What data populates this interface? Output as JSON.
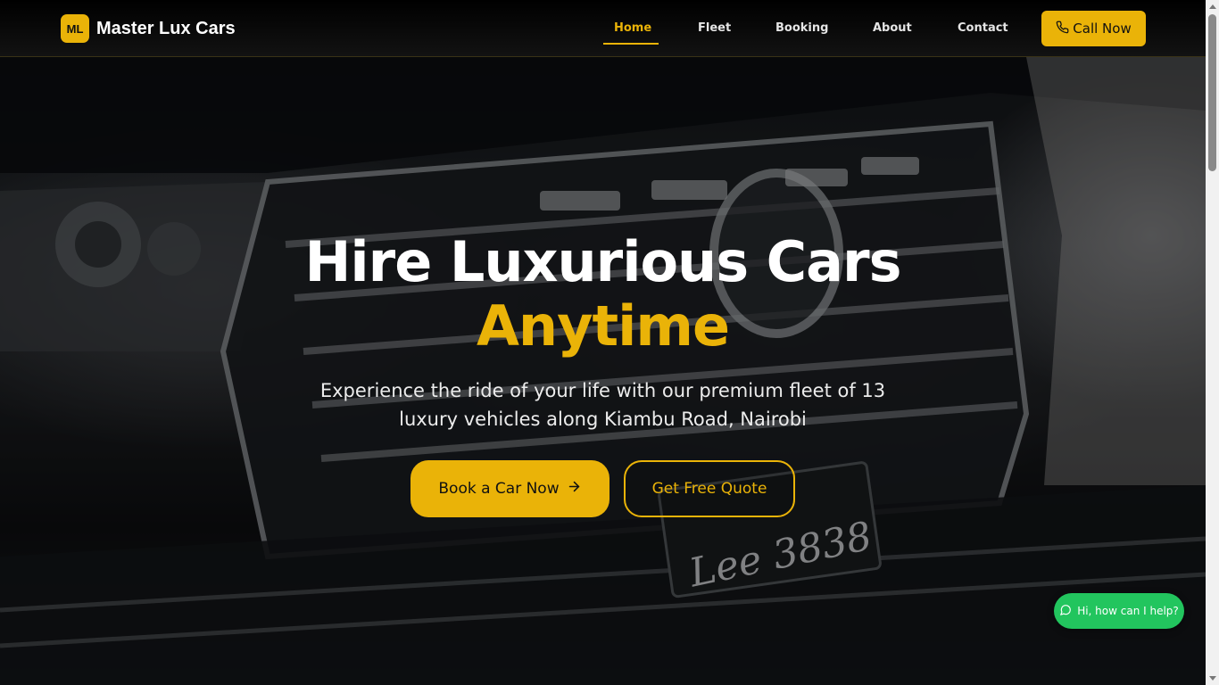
{
  "header": {
    "logo_badge": "ML",
    "brand_name": "Master Lux Cars",
    "nav": [
      {
        "label": "Home",
        "active": true
      },
      {
        "label": "Fleet",
        "active": false
      },
      {
        "label": "Booking",
        "active": false
      },
      {
        "label": "About",
        "active": false
      },
      {
        "label": "Contact",
        "active": false
      }
    ],
    "call_button": {
      "label": "Call Now",
      "icon": "phone-icon"
    }
  },
  "hero": {
    "title_line1": "Hire Luxurious Cars",
    "title_line2": "Anytime",
    "subtitle": "Experience the ride of your life with our premium fleet of 13 luxury vehicles along Kiambu Road, Nairobi",
    "primary_button": {
      "label": "Book a Car Now",
      "icon": "arrow-right-icon"
    },
    "secondary_button": {
      "label": "Get Free Quote"
    },
    "background_plate_text": "Lee 3838"
  },
  "chat_widget": {
    "label": "Hi, how can I help?",
    "icon": "chat-bubble-icon"
  },
  "colors": {
    "accent": "#eab308",
    "chat": "#22c55e",
    "header_bg": "#000000",
    "text_light": "#ffffff"
  }
}
